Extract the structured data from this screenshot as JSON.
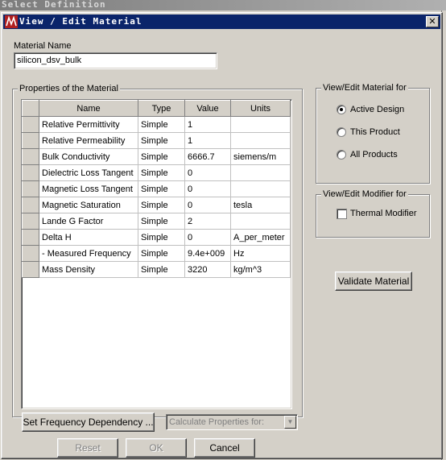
{
  "background": {
    "title": "Select Definition"
  },
  "dialog": {
    "title": "View / Edit Material",
    "material_name_label": "Material Name",
    "material_name_value": "silicon_dsv_bulk",
    "properties_group_label": "Properties of the Material",
    "columns": [
      "Name",
      "Type",
      "Value",
      "Units"
    ],
    "rows": [
      {
        "name": "Relative Permittivity",
        "type": "Simple",
        "value": "1",
        "units": ""
      },
      {
        "name": "Relative Permeability",
        "type": "Simple",
        "value": "1",
        "units": ""
      },
      {
        "name": "Bulk Conductivity",
        "type": "Simple",
        "value": "6666.7",
        "units": "siemens/m"
      },
      {
        "name": "Dielectric Loss Tangent",
        "type": "Simple",
        "value": "0",
        "units": ""
      },
      {
        "name": "Magnetic Loss Tangent",
        "type": "Simple",
        "value": "0",
        "units": ""
      },
      {
        "name": "Magnetic Saturation",
        "type": "Simple",
        "value": "0",
        "units": "tesla"
      },
      {
        "name": "Lande G Factor",
        "type": "Simple",
        "value": "2",
        "units": ""
      },
      {
        "name": "Delta H",
        "type": "Simple",
        "value": "0",
        "units": "A_per_meter"
      },
      {
        "name": "-  Measured Frequency",
        "type": "Simple",
        "value": "9.4e+009",
        "units": "Hz"
      },
      {
        "name": "Mass Density",
        "type": "Simple",
        "value": "3220",
        "units": "kg/m^3"
      }
    ],
    "view_edit_group_label": "View/Edit Material for",
    "radio_options": [
      {
        "label": "Active Design",
        "selected": true
      },
      {
        "label": "This Product",
        "selected": false
      },
      {
        "label": "All Products",
        "selected": false
      }
    ],
    "modifier_group_label": "View/Edit Modifier for",
    "thermal_modifier_label": "Thermal Modifier",
    "thermal_modifier_checked": false,
    "validate_button": "Validate Material",
    "set_freq_button": "Set Frequency Dependency ...",
    "calc_props_placeholder": "Calculate Properties for:",
    "reset_button": "Reset",
    "ok_button": "OK",
    "cancel_button": "Cancel"
  },
  "colors": {
    "titlebar": "#0a246a",
    "face": "#d4d0c8"
  }
}
